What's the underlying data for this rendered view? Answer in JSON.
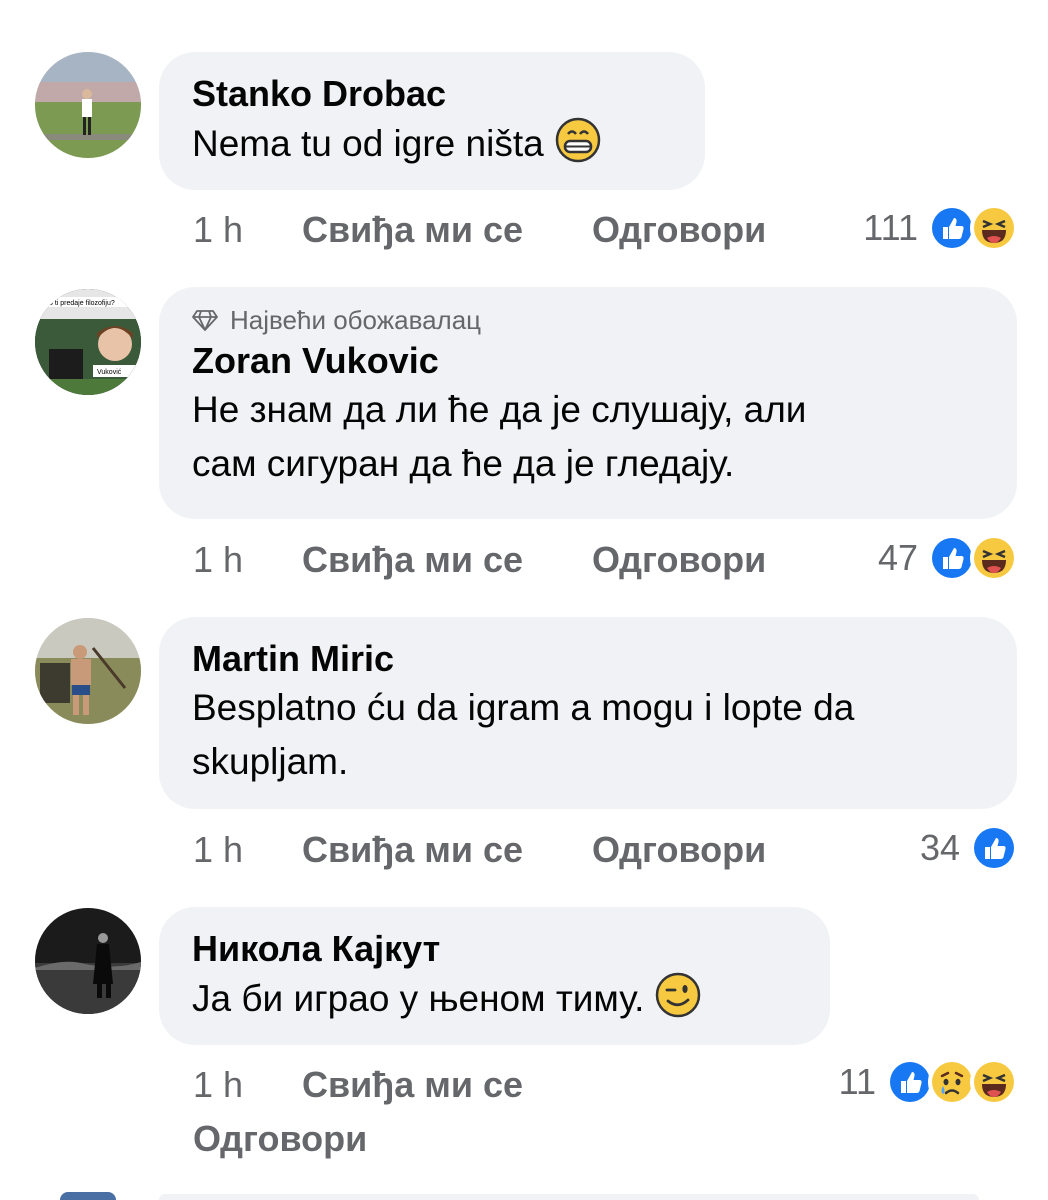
{
  "comments": [
    {
      "author": "Stanko Drobac",
      "text": "Nema tu od igre ništa",
      "emoji": "grinning-face-emoji",
      "time": "1 h",
      "like_label": "Свиђа ми се",
      "reply_label": "Одговори",
      "reaction_count": "111",
      "reactions": [
        "like-reaction-icon",
        "haha-reaction-icon"
      ]
    },
    {
      "badge": "Највећи обожавалац",
      "author": "Zoran Vukovic",
      "text_lines": [
        "Не знам да ли ће да је слушају, али",
        "сам сигуран да ће да је гледају."
      ],
      "time": "1 h",
      "like_label": "Свиђа ми се",
      "reply_label": "Одговори",
      "reaction_count": "47",
      "reactions": [
        "like-reaction-icon",
        "haha-reaction-icon"
      ]
    },
    {
      "author": "Martin Miric",
      "text_lines": [
        "Besplatno ću da igram a mogu i lopte da",
        "skupljam."
      ],
      "time": "1 h",
      "like_label": "Свиђа ми се",
      "reply_label": "Одговори",
      "reaction_count": "34",
      "reactions": [
        "like-reaction-icon"
      ]
    },
    {
      "author": "Никола Кајкут",
      "text": "Ја би играо у њеном тиму.",
      "emoji": "winking-face-emoji",
      "time": "1 h",
      "like_label": "Свиђа ми се",
      "reply_label": "Одговори",
      "reaction_count": "11",
      "reactions": [
        "like-reaction-icon",
        "sad-reaction-icon",
        "haha-reaction-icon"
      ]
    }
  ],
  "avatar_texts": {
    "zoran_caption_top": "o ti predaje filozofiju?",
    "zoran_caption_name": "Vuković"
  },
  "colors": {
    "bubble_bg": "#f0f2f5",
    "secondary_text": "#65676b",
    "like_blue": "#1877f2",
    "emoji_yellow": "#f7c940"
  }
}
